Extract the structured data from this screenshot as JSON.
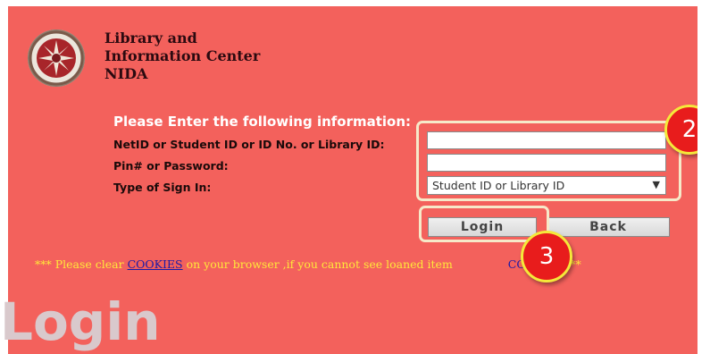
{
  "header": {
    "library_line1": "Library and",
    "library_line2": "Information Center",
    "library_line3": "NIDA"
  },
  "form": {
    "prompt": "Please Enter the following information:",
    "id_label": "NetID or Student ID or ID No. or Library ID:",
    "id_value": "",
    "pin_label": "Pin# or Password:",
    "pin_value": "",
    "type_label": "Type of Sign In:",
    "type_selected": "Student ID or Library ID",
    "login_label": "Login",
    "back_label": "Back"
  },
  "notice": {
    "part1": "*** Please clear ",
    "cookies_link": "COOKIES",
    "part2": " on your browser ,if you cannot see loaned item",
    "account_link": "CCOUNT",
    "part3": " ***"
  },
  "annotations": {
    "badge_2": "2",
    "badge_3": "3"
  },
  "page": {
    "title": "Login"
  },
  "colors": {
    "panel_background": "#f3615c",
    "notice_text": "#ffe83a",
    "badge_fill": "#e81c1c",
    "badge_border": "#f5e83a",
    "highlight_border": "#f6e9c9"
  },
  "icons": {
    "seal": "nida-seal-icon",
    "dropdown": "chevron-down-icon"
  }
}
